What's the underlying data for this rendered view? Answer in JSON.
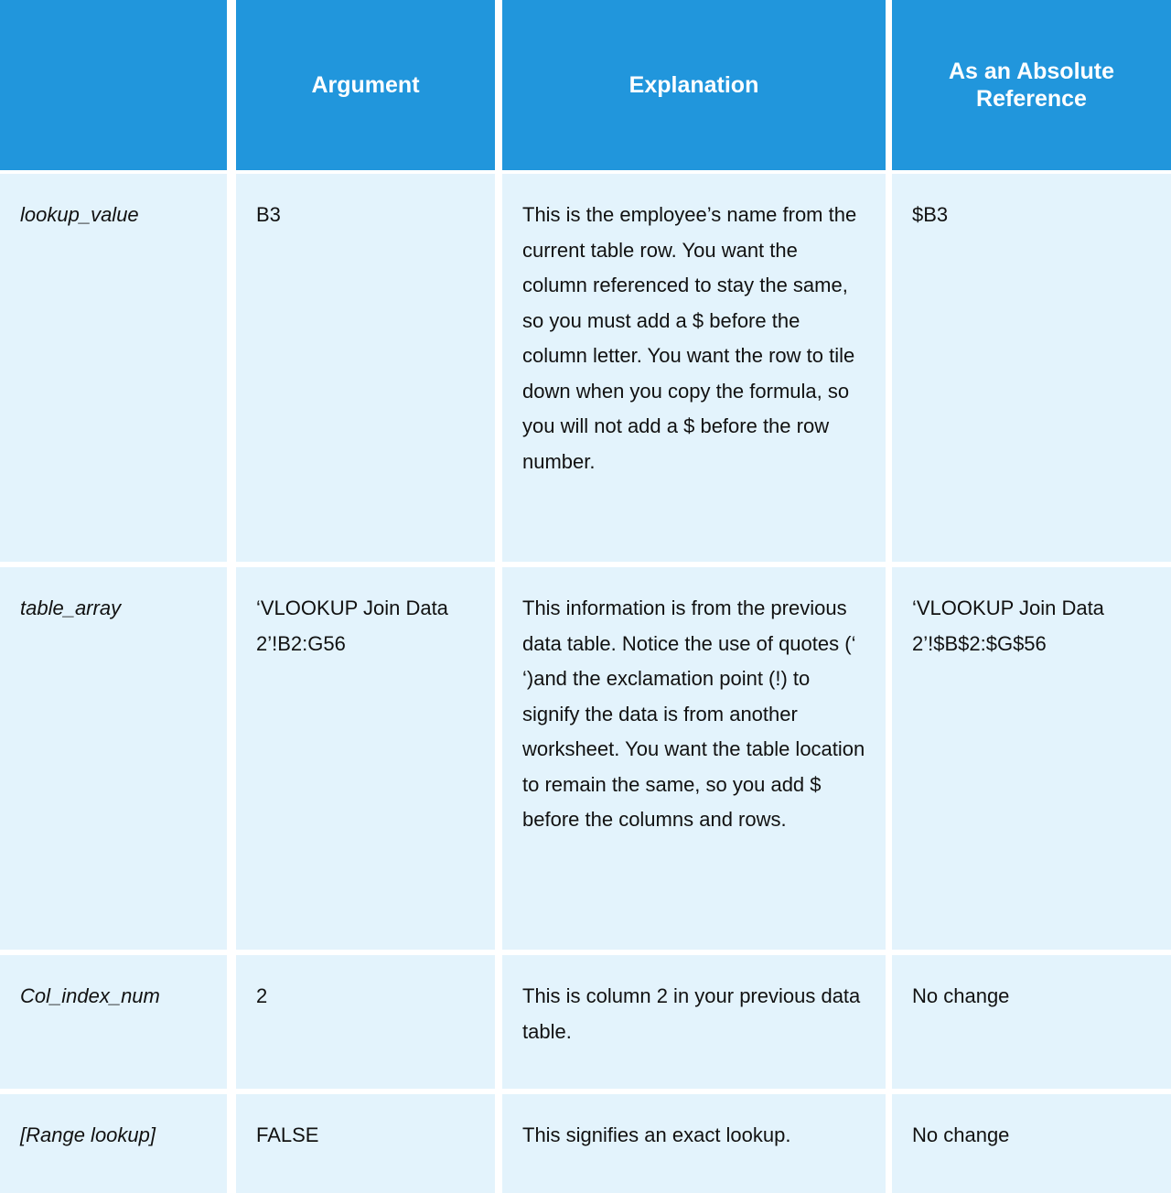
{
  "table": {
    "headers": [
      {
        "label": "",
        "name": "header-argument-name"
      },
      {
        "label": "Argument",
        "name": "header-argument"
      },
      {
        "label": "Explanation",
        "name": "header-explanation"
      },
      {
        "label": "As an Absolute Reference",
        "name": "header-absolute-reference"
      }
    ],
    "accent_color": "#2196DC",
    "cell_background": "#E3F3FC",
    "rows": [
      {
        "argument_name": "lookup_value",
        "argument": "B3",
        "explanation": "This is the employee’s name from the current table row. You want the column referenced to stay the same, so you must add a $ before the column letter. You want the row to tile down when you copy the formula, so you will not add a $ before the row number.",
        "absolute_reference": "$B3"
      },
      {
        "argument_name": "table_array",
        "argument": "‘VLOOKUP Join Data 2’!B2:G56",
        "explanation": "This information is from the previous data table. Notice the use of quotes (‘ ‘)and the exclamation point (!) to signify the data is from another worksheet. You want the table location to remain the same, so you add $ before the columns and rows.",
        "absolute_reference": "‘VLOOKUP Join Data 2’!$B$2:$G$56"
      },
      {
        "argument_name": "Col_index_num",
        "argument": "2",
        "explanation": "This is column 2 in your previous data table.",
        "absolute_reference": "No change"
      },
      {
        "argument_name": "[Range lookup]",
        "argument": "FALSE",
        "explanation": "This signifies an exact lookup.",
        "absolute_reference": "No change"
      }
    ]
  }
}
